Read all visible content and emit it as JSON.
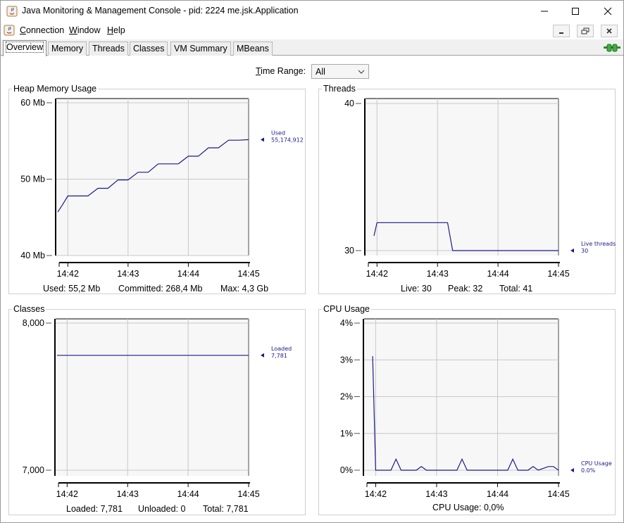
{
  "window": {
    "title": "Java Monitoring & Management Console - pid: 2224 me.jsk.Application"
  },
  "menu": [
    {
      "pre": "",
      "u": "C",
      "post": "onnection"
    },
    {
      "pre": "",
      "u": "W",
      "post": "indow"
    },
    {
      "pre": "",
      "u": "H",
      "post": "elp"
    }
  ],
  "tabs": [
    "Overview",
    "Memory",
    "Threads",
    "Classes",
    "VM Summary",
    "MBeans"
  ],
  "active_tab": "Overview",
  "time_range": {
    "label_u": "T",
    "label_rest": "ime Range:",
    "value": "All"
  },
  "panels": {
    "heap": {
      "title": "Heap Memory Usage",
      "summary": {
        "used": "Used: 55,2 Mb",
        "committed": "Committed: 268,4 Mb",
        "max": "Max: 4,3 Gb"
      }
    },
    "threads": {
      "title": "Threads",
      "summary": {
        "live": "Live: 30",
        "peak": "Peak: 32",
        "total": "Total: 41"
      }
    },
    "classes": {
      "title": "Classes",
      "summary": {
        "loaded": "Loaded: 7,781",
        "unloaded": "Unloaded: 0",
        "total": "Total: 7,781"
      }
    },
    "cpu": {
      "title": "CPU Usage",
      "summary": {
        "cpu": "CPU Usage: 0,0%"
      }
    }
  },
  "chart_data": [
    {
      "id": "heap",
      "type": "line",
      "x": [
        "14:41:50",
        "14:41:55",
        "14:42:00",
        "14:42:10",
        "14:42:20",
        "14:42:30",
        "14:42:40",
        "14:42:50",
        "14:43:00",
        "14:43:10",
        "14:43:20",
        "14:43:30",
        "14:43:40",
        "14:43:50",
        "14:44:00",
        "14:44:10",
        "14:44:20",
        "14:44:30",
        "14:44:40",
        "14:44:50",
        "14:45:00"
      ],
      "y": [
        45.7,
        46.7,
        47.8,
        47.8,
        47.8,
        48.8,
        48.8,
        49.9,
        49.9,
        50.9,
        50.9,
        52.0,
        52.0,
        52.0,
        53.0,
        53.0,
        54.1,
        54.1,
        55.1,
        55.1,
        55.17
      ],
      "y_ticks": [
        "60 Mb",
        "50 Mb",
        "40 Mb"
      ],
      "ylim": [
        40,
        60
      ],
      "x_ticks": [
        "14:42",
        "14:43",
        "14:44",
        "14:45"
      ],
      "series": [
        {
          "name": "Used",
          "last_label": "55,174,912",
          "color": "#1a1a8c"
        }
      ],
      "grid": true
    },
    {
      "id": "threads",
      "type": "line",
      "x": [
        "14:41:57",
        "14:42:00",
        "14:43:10",
        "14:43:15",
        "14:45:00"
      ],
      "y": [
        31.0,
        31.9,
        31.9,
        30.0,
        30.0
      ],
      "y_ticks": [
        "40",
        "30"
      ],
      "ylim": [
        30,
        40
      ],
      "x_ticks": [
        "14:42",
        "14:43",
        "14:44",
        "14:45"
      ],
      "series": [
        {
          "name": "Live threads",
          "last_label": "30",
          "color": "#1a1a8c"
        }
      ],
      "grid": true
    },
    {
      "id": "classes",
      "type": "line",
      "x": [
        "14:41:50",
        "14:45:00"
      ],
      "y": [
        7781,
        7781
      ],
      "y_ticks": [
        "8,000",
        "7,000"
      ],
      "ylim": [
        7000,
        8000
      ],
      "x_ticks": [
        "14:42",
        "14:43",
        "14:44",
        "14:45"
      ],
      "series": [
        {
          "name": "Loaded",
          "last_label": "7,781",
          "color": "#1a1a8c"
        }
      ],
      "grid": true
    },
    {
      "id": "cpu",
      "type": "line",
      "x": [
        "14:41:57",
        "14:42:00",
        "14:42:15",
        "14:42:20",
        "14:42:25",
        "14:42:40",
        "14:42:45",
        "14:42:50",
        "14:43:20",
        "14:43:25",
        "14:43:30",
        "14:44:10",
        "14:44:15",
        "14:44:20",
        "14:44:30",
        "14:44:35",
        "14:44:40",
        "14:44:50",
        "14:44:55",
        "14:45:00"
      ],
      "y": [
        3.1,
        0.0,
        0.0,
        0.3,
        0.0,
        0.0,
        0.1,
        0.0,
        0.0,
        0.3,
        0.0,
        0.0,
        0.3,
        0.0,
        0.0,
        0.1,
        0.0,
        0.1,
        0.1,
        0.0
      ],
      "y_ticks": [
        "4%",
        "3%",
        "2%",
        "1%",
        "0%"
      ],
      "ylim": [
        0,
        4
      ],
      "x_ticks": [
        "14:42",
        "14:43",
        "14:44",
        "14:45"
      ],
      "series": [
        {
          "name": "CPU Usage",
          "last_label": "0.0%",
          "color": "#1a1a8c"
        }
      ],
      "grid": true
    }
  ]
}
